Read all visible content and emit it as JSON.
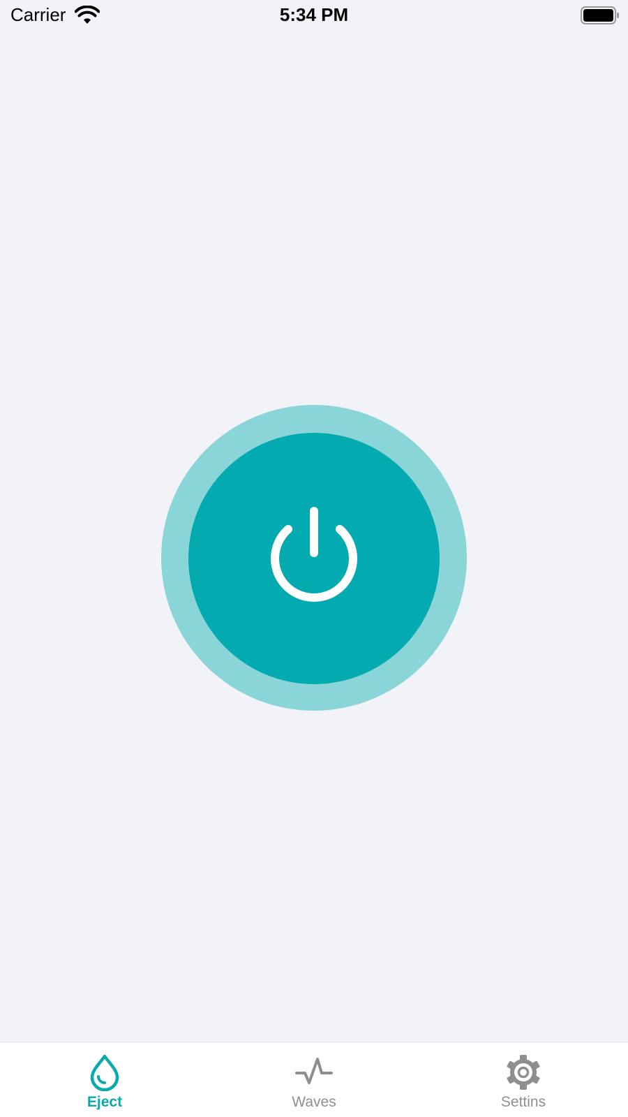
{
  "status_bar": {
    "carrier": "Carrier",
    "time": "5:34 PM",
    "wifi_icon": "wifi-icon",
    "battery_icon": "battery-icon"
  },
  "main": {
    "power_button_icon": "power-icon",
    "outer_ring_color": "#89d5d8",
    "inner_color": "#03aaaf"
  },
  "tab_bar": {
    "active_color": "#09a9ae",
    "inactive_color": "#8e8e93",
    "tabs": [
      {
        "label": "Eject",
        "icon": "water-drop-icon",
        "active": true
      },
      {
        "label": "Waves",
        "icon": "pulse-wave-icon",
        "active": false
      },
      {
        "label": "Settins",
        "icon": "gear-icon",
        "active": false
      }
    ]
  }
}
